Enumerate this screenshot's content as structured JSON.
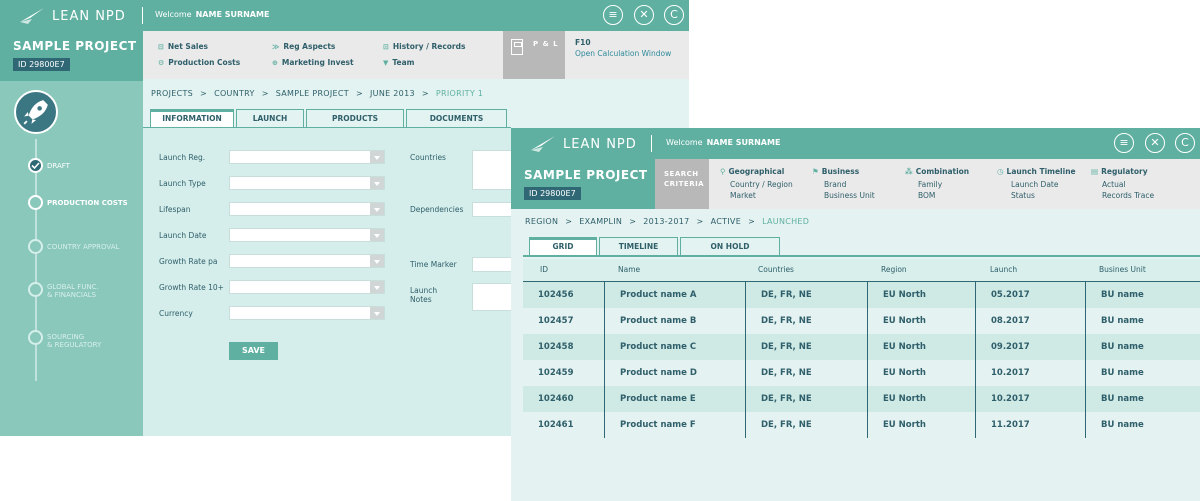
{
  "app": {
    "name": "LEAN NPD",
    "welcome": "Welcome",
    "user": "NAME SURNAME"
  },
  "project": {
    "title": "SAMPLE PROJECT",
    "id": "ID 29800E7"
  },
  "toolbar": {
    "menu_icon": "menu-icon",
    "close_icon": "close-icon",
    "copyright_icon": "copyright-icon"
  },
  "window1": {
    "steps": [
      {
        "label": "DRAFT",
        "state": "done"
      },
      {
        "label": "PRODUCTION COSTS",
        "state": "current"
      },
      {
        "label": "COUNTRY APPROVAL",
        "state": "todo"
      },
      {
        "label": "GLOBAL FUNC.\n& FINANCIALS",
        "state": "todo"
      },
      {
        "label": "SOURCING\n& REGULATORY",
        "state": "todo"
      }
    ],
    "menu": [
      "Net Sales",
      "Production Costs",
      "Reg Aspects",
      "Marketing Invest",
      "History / Records",
      "Team"
    ],
    "pl": {
      "label": "P & L",
      "key": "F10",
      "action": "Open Calculation Window"
    },
    "breadcrumb": [
      "PROJECTS",
      "COUNTRY",
      "SAMPLE PROJECT",
      "JUNE 2013",
      "PRIORITY 1"
    ],
    "tabs": [
      "INFORMATION",
      "LAUNCH",
      "PRODUCTS",
      "DOCUMENTS"
    ],
    "form_left": [
      "Launch Reg.",
      "Launch Type",
      "Lifespan",
      "Launch Date",
      "Growth Rate pa",
      "Growth Rate 10+",
      "Currency"
    ],
    "form_right": [
      "Countries",
      "Dependencies",
      "Time Marker",
      "Launch\nNotes"
    ],
    "save": "SAVE"
  },
  "window2": {
    "search_criteria": "SEARCH\nCRITERIA",
    "criteria": [
      {
        "title": "Geographical",
        "items": [
          "Country / Region",
          "Market"
        ]
      },
      {
        "title": "Business",
        "items": [
          "Brand",
          "Business Unit"
        ]
      },
      {
        "title": "Combination",
        "items": [
          "Family",
          "BOM"
        ]
      },
      {
        "title": "Launch Timeline",
        "items": [
          "Launch Date",
          "Status"
        ]
      },
      {
        "title": "Regulatory",
        "items": [
          "Actual",
          "Records Trace"
        ]
      }
    ],
    "breadcrumb": [
      "REGION",
      "EXAMPLIN",
      "2013-2017",
      "ACTIVE",
      "LAUNCHED"
    ],
    "tabs": [
      "GRID",
      "TIMELINE",
      "ON HOLD"
    ],
    "columns": [
      "ID",
      "Name",
      "Countries",
      "Region",
      "Launch",
      "Busines Unit"
    ],
    "rows": [
      [
        "102456",
        "Product name A",
        "DE, FR, NE",
        "EU North",
        "05.2017",
        "BU name"
      ],
      [
        "102457",
        "Product name B",
        "DE, FR, NE",
        "EU North",
        "08.2017",
        "BU name"
      ],
      [
        "102458",
        "Product name C",
        "DE, FR, NE",
        "EU North",
        "09.2017",
        "BU name"
      ],
      [
        "102459",
        "Product name D",
        "DE, FR, NE",
        "EU North",
        "10.2017",
        "BU name"
      ],
      [
        "102460",
        "Product name E",
        "DE, FR, NE",
        "EU North",
        "10.2017",
        "BU name"
      ],
      [
        "102461",
        "Product name F",
        "DE, FR, NE",
        "EU North",
        "11.2017",
        "BU name"
      ]
    ]
  },
  "colors": {
    "teal": "#5fb0a1",
    "dark_teal": "#2f6775",
    "light_bg": "#e3f3f1",
    "grey": "#b8b8b8"
  }
}
